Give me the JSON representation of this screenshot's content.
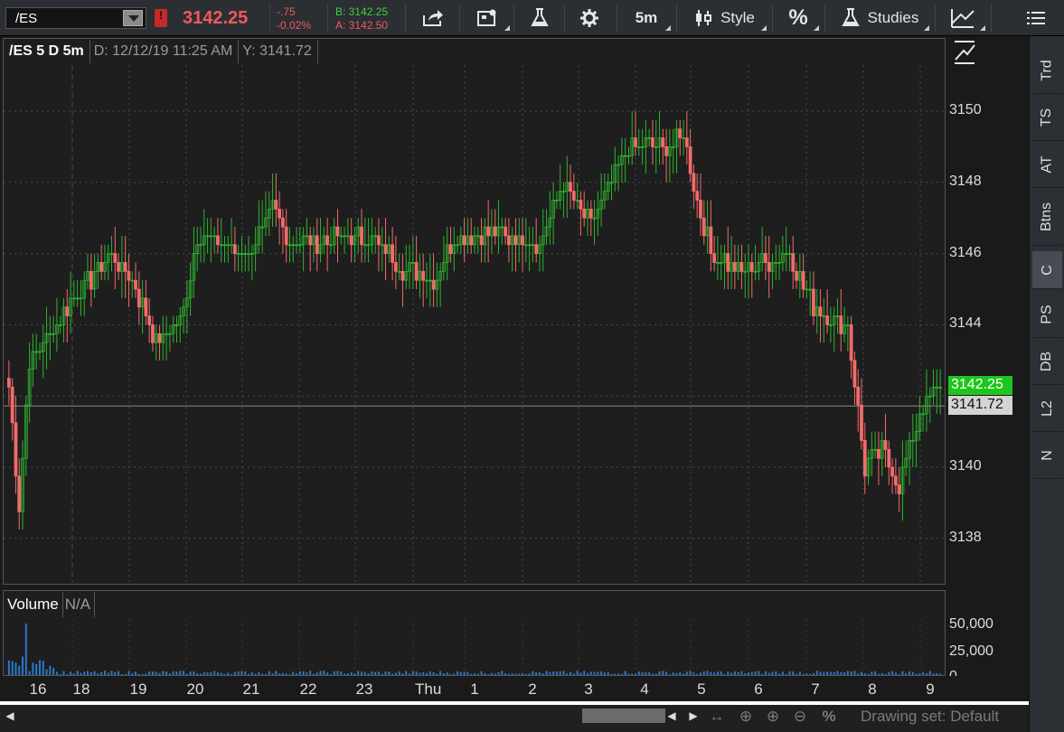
{
  "toolbar": {
    "symbol": "/ES",
    "alert_badge": "!",
    "last_price": "3142.25",
    "net_change": "-.75",
    "pct_change": "-0.02%",
    "bid": "B: 3142.25",
    "ask": "A: 3142.50",
    "timeframe_label": "5m",
    "style_label": "Style",
    "percent_label": "%",
    "studies_label": "Studies",
    "icons": [
      "share-icon",
      "drawer-icon",
      "flask-icon",
      "gear-icon",
      "style-icon",
      "studies-flask-icon",
      "drawings-icon",
      "menu-icon"
    ]
  },
  "chart": {
    "title": "/ES 5 D 5m",
    "date_readout": "D: 12/12/19 11:25 AM",
    "y_readout": "Y: 3141.72",
    "price_ticks": [
      "3150",
      "3148",
      "3146",
      "3144",
      "3142",
      "3140",
      "3138"
    ],
    "last_tag": "3142.25",
    "crosshair_tag": "3141.72",
    "colors": {
      "up": "#2fb32f",
      "down": "#f26b6b",
      "last_tag": "#1ec51e",
      "background": "#1e1e1e"
    }
  },
  "volume": {
    "title": "Volume",
    "value": "N/A",
    "ticks": [
      "50,000",
      "25,000",
      "0"
    ]
  },
  "time_axis": {
    "labels": [
      "16",
      "18",
      "19",
      "20",
      "21",
      "22",
      "23",
      "Thu",
      "1",
      "2",
      "3",
      "4",
      "5",
      "6",
      "7",
      "8",
      "9"
    ]
  },
  "sidebar": {
    "tabs": [
      {
        "label": "Trd"
      },
      {
        "label": "TS"
      },
      {
        "label": "AT"
      },
      {
        "label": "Btns"
      },
      {
        "label": "C"
      },
      {
        "label": "PS"
      },
      {
        "label": "DB"
      },
      {
        "label": "L2"
      },
      {
        "label": "N"
      }
    ],
    "active": "C"
  },
  "bottom_bar": {
    "drawing_set": "Drawing set: Default",
    "percent_icon": "%"
  },
  "chart_data": {
    "type": "candlestick",
    "x_label_ticks": [
      "16",
      "18",
      "19",
      "20",
      "21",
      "22",
      "23",
      "Thu",
      "1",
      "2",
      "3",
      "4",
      "5",
      "6",
      "7",
      "8",
      "9"
    ],
    "ylim": [
      3137,
      3152
    ],
    "yticks": [
      3138,
      3140,
      3142,
      3144,
      3146,
      3148,
      3150
    ],
    "grid": true,
    "waypoints": [
      [
        0,
        3142.2
      ],
      [
        3,
        3139.0
      ],
      [
        6,
        3143.0
      ],
      [
        10,
        3143.5
      ],
      [
        17,
        3144.5
      ],
      [
        30,
        3146.0
      ],
      [
        37,
        3145.0
      ],
      [
        43,
        3143.5
      ],
      [
        50,
        3144.0
      ],
      [
        55,
        3146.5
      ],
      [
        70,
        3146.0
      ],
      [
        77,
        3147.2
      ],
      [
        82,
        3146.3
      ],
      [
        105,
        3146.5
      ],
      [
        115,
        3145.6
      ],
      [
        125,
        3145.3
      ],
      [
        130,
        3146.5
      ],
      [
        140,
        3146.6
      ],
      [
        155,
        3146.3
      ],
      [
        162,
        3148.0
      ],
      [
        170,
        3146.8
      ],
      [
        178,
        3148.5
      ],
      [
        182,
        3149.0
      ],
      [
        192,
        3149.0
      ],
      [
        197,
        3149.3
      ],
      [
        200,
        3148.0
      ],
      [
        205,
        3146.0
      ],
      [
        215,
        3145.5
      ],
      [
        222,
        3145.8
      ],
      [
        228,
        3146.0
      ],
      [
        235,
        3144.5
      ],
      [
        245,
        3144.0
      ],
      [
        250,
        3140.0
      ],
      [
        255,
        3140.5
      ],
      [
        260,
        3139.5
      ],
      [
        266,
        3141.5
      ],
      [
        272,
        3142.25
      ]
    ],
    "volume_spike_bars": [
      [
        5,
        50000
      ],
      [
        4,
        18000
      ],
      [
        7,
        12000
      ]
    ]
  }
}
